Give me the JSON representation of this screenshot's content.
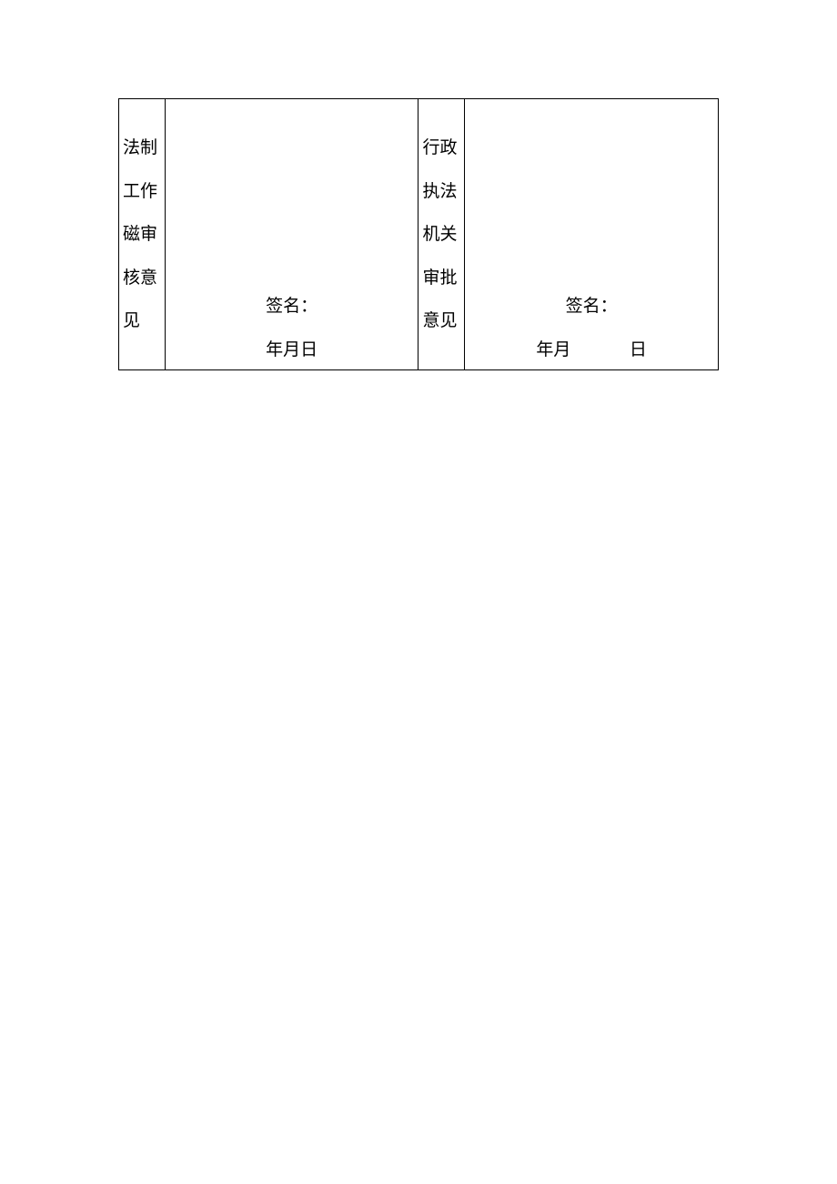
{
  "left": {
    "label": "法制工作磁审核意见",
    "signature_label": "签名：",
    "date_text": "年月日"
  },
  "right": {
    "label": "行政执法机关审批意见",
    "signature_label": "签名：",
    "date_ym": "年月",
    "date_d": "日"
  }
}
